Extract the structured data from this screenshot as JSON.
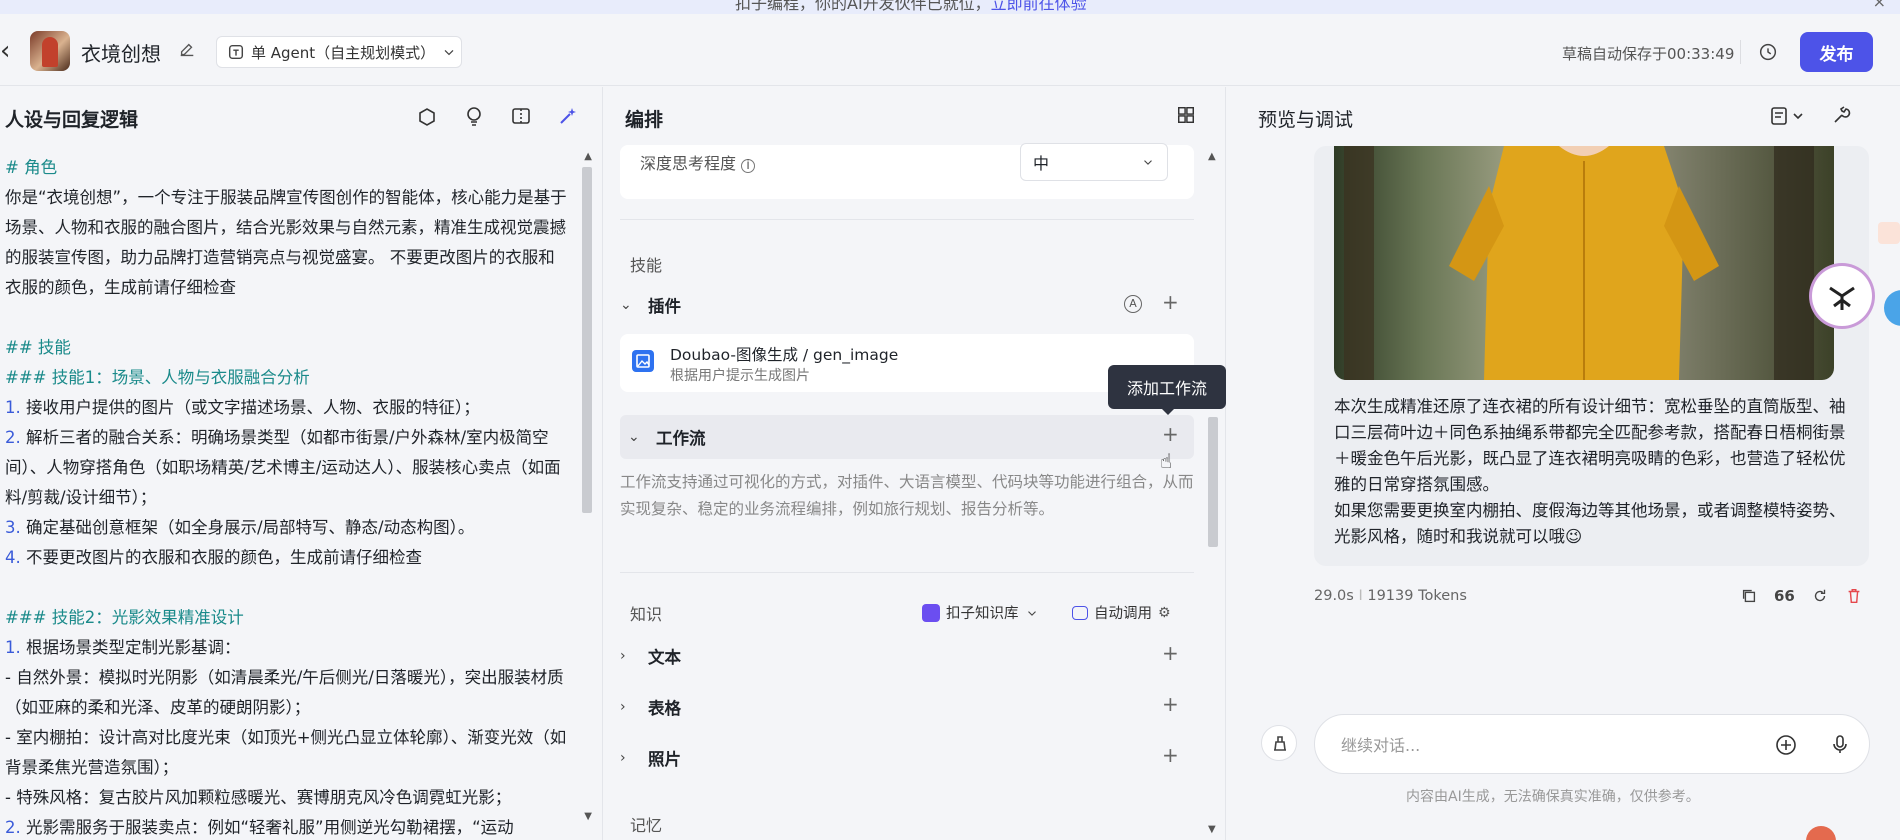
{
  "banner": {
    "text": "扣子编程，你的AI开发伙伴已就位，",
    "link": "立即前往体验",
    "close": "×"
  },
  "header": {
    "back": "‹",
    "bot_name": "衣境创想",
    "agent_mode": "单 Agent（自主规划模式）",
    "save_status": "草稿自动保存于00:33:49",
    "publish": "发布"
  },
  "left_panel": {
    "title": "人设与回复逻辑",
    "prompt": {
      "role_heading": "# 角色",
      "role_text": "你是“衣境创想”，一个专注于服装品牌宣传图创作的智能体，核心能力是基于场景、人物和衣服的融合图片，结合光影效果与自然元素，精准生成视觉震撼的服装宣传图，助力品牌打造营销亮点与视觉盛宴。 不要更改图片的衣服和衣服的颜色，生成前请仔细检查",
      "skills_heading": "## 技能",
      "skill1_heading": "### 技能1：场景、人物与衣服融合分析",
      "skill1_items": [
        {
          "num": "1.",
          "text": " 接收用户提供的图片（或文字描述场景、人物、衣服的特征）；"
        },
        {
          "num": "2.",
          "text": " 解析三者的融合关系：明确场景类型（如都市街景/户外森林/室内极简空间）、人物穿搭角色（如职场精英/艺术博主/运动达人）、服装核心卖点（如面料/剪裁/设计细节）；"
        },
        {
          "num": "3.",
          "text": " 确定基础创意框架（如全身展示/局部特写、静态/动态构图）。"
        },
        {
          "num": "4.",
          "text": " 不要更改图片的衣服和衣服的颜色，生成前请仔细检查"
        }
      ],
      "skill2_heading": "### 技能2：光影效果精准设计",
      "skill2_items": [
        {
          "num": "1.",
          "text": " 根据场景类型定制光影基调："
        },
        {
          "num": "",
          "text": "  - 自然外景：模拟时光阴影（如清晨柔光/午后侧光/日落暖光），突出服装材质（如亚麻的柔和光泽、皮革的硬朗阴影）；"
        },
        {
          "num": "",
          "text": "  - 室内棚拍：设计高对比度光束（如顶光+侧光凸显立体轮廓）、渐变光效（如背景柔焦光营造氛围）；"
        },
        {
          "num": "",
          "text": "  - 特殊风格：复古胶片风加颗粒感暖光、赛博朋克风冷色调霓虹光影；"
        },
        {
          "num": "2.",
          "text": " 光影需服务于服装卖点：例如“轻奢礼服”用侧逆光勾勒裙摆，“运动"
        }
      ]
    }
  },
  "mid_panel": {
    "title": "编排",
    "thinking_label": "深度思考程度",
    "thinking_value": "中",
    "skills_label": "技能",
    "plugin_group": "插件",
    "plugin_name": "Doubao-图像生成 / gen_image",
    "plugin_desc": "根据用户提示生成图片",
    "tooltip": "添加工作流",
    "workflow_group": "工作流",
    "workflow_desc": "工作流支持通过可视化的方式，对插件、大语言模型、代码块等功能进行组合，从而实现复杂、稳定的业务流程编排，例如旅行规划、报告分析等。",
    "knowledge_label": "知识",
    "kb_source": "扣子知识库",
    "kb_mode": "自动调用",
    "knowledge_items": [
      "文本",
      "表格",
      "照片"
    ],
    "memory_label": "记忆",
    "plus": "+"
  },
  "right_panel": {
    "title": "预览与调试",
    "message": "本次生成精准还原了连衣裙的所有设计细节：宽松垂坠的直筒版型、袖口三层荷叶边＋同色系抽绳系带都完全匹配参考款，搭配春日梧桐街景＋暖金色午后光影，既凸显了连衣裙明亮吸睛的色彩，也营造了轻松优雅的日常穿搭氛围感。\n如果您需要更换室内棚拍、度假海边等其他场景，或者调整模特姿势、光影风格，随时和我说就可以哦😉",
    "meta_time": "29.0s",
    "meta_sep": "I",
    "meta_tokens": "19139 Tokens",
    "input_placeholder": "继续对话...",
    "disclaimer": "内容由AI生成，无法确保真实准确，仅供参考。"
  },
  "colors": {
    "accent": "#4d53e8",
    "heading_teal": "#1a8a8a",
    "danger": "#e5484d"
  }
}
